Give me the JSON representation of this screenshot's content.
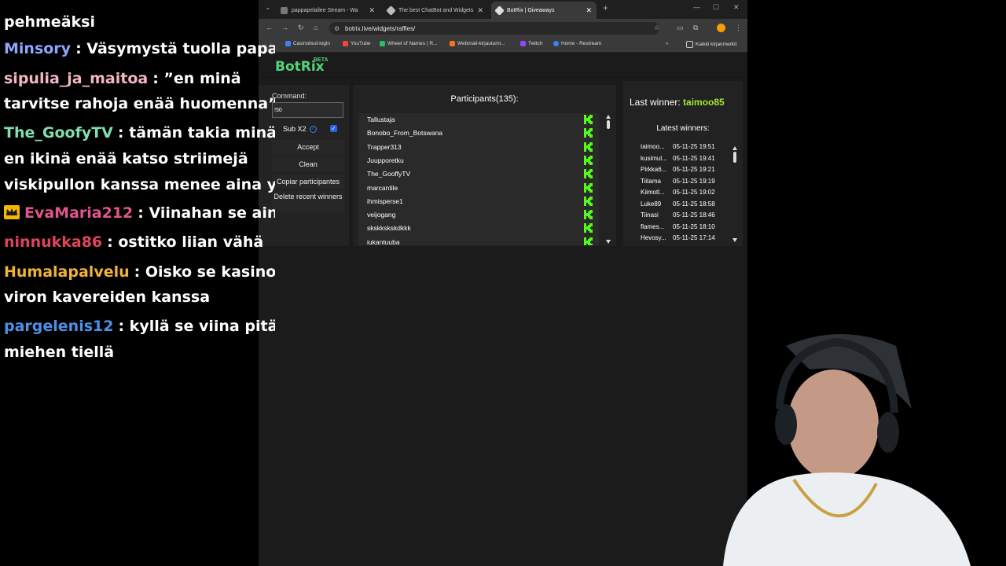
{
  "chat": {
    "messages": [
      {
        "user": "",
        "text": "pehmeäksi",
        "color": "#ffffff"
      },
      {
        "user": "Minsory",
        "text": ": Väsymystä tuolla papalla",
        "color": "#8fa8ff"
      },
      {
        "user": "sipulia_ja_maitoa",
        "text": ": ”en minä",
        "color": "#f4b6c2"
      },
      {
        "user": "",
        "text": "tarvitse rahoja enää huomenna”",
        "color": "#ffffff"
      },
      {
        "user": "The_GoofyTV",
        "text": ": tämän takia minä",
        "color": "#7fe0b0"
      },
      {
        "user": "",
        "text": "en ikinä enää katso striimejä",
        "color": "#ffffff"
      },
      {
        "user": "",
        "text": "viskipullon kanssa menee aina yli",
        "color": "#ffffff"
      },
      {
        "user": "EvaMaria212",
        "text": ": Viinahan se aina",
        "color": "#e0568a"
      },
      {
        "user": "ninnukka86",
        "text": ": ostitko liian vähä",
        "color": "#e0445a"
      },
      {
        "user": "Humalapalvelu",
        "text": ": Oisko se kasinolle",
        "color": "#f0b23a"
      },
      {
        "user": "",
        "text": "viron kavereiden kanssa",
        "color": "#ffffff"
      },
      {
        "user": "pargelenis12",
        "text": ": kyllä se viina pitää",
        "color": "#4f8fe8"
      },
      {
        "user": "",
        "text": "miehen tiellä",
        "color": "#ffffff"
      }
    ]
  },
  "browser": {
    "tabs": [
      {
        "title": "pappapelailee Stream - Wa",
        "active": false
      },
      {
        "title": "The best ChatBot and Widgets",
        "active": false
      },
      {
        "title": "BotRix | Giveaways",
        "active": true
      }
    ],
    "url": "botrix.live/widgets/raffles/",
    "bookmarks": [
      {
        "label": "Casinobud-login",
        "color": "#3b82f6"
      },
      {
        "label": "YouTube",
        "color": "#ef4444"
      },
      {
        "label": "Wheel of Names | R...",
        "color": "#22c55e"
      },
      {
        "label": "Webmail-kirjautumi...",
        "color": "#f97316"
      },
      {
        "label": "Twitch",
        "color": "#9146ff"
      },
      {
        "label": "Home - Restream",
        "color": "#3b82f6"
      }
    ],
    "all_bookmarks": "Kaikki kirjanmerkit"
  },
  "botrix": {
    "brand": "BotRix",
    "beta": "BETA",
    "command_label": "Command:",
    "command_value": "!50",
    "sub_x2_label": "Sub X2",
    "sub_x2_checked": true,
    "buttons": {
      "accept": "Accept",
      "clean": "Clean",
      "copy": "Copiar participantes",
      "delete": "Delete recent winners"
    },
    "participants_title": "Participants(135):",
    "participants": [
      "Tallustaja",
      "Bonobo_From_Botswana",
      "Trapper313",
      "Juupporetku",
      "The_GooffyTV",
      "marcantile",
      "ihmisperse1",
      "veijogang",
      "skskkskskdkkk",
      "iukantuuba"
    ],
    "platform_icon": "kick-icon",
    "platform_color": "#53fc18",
    "last_winner_label": "Last winner:",
    "last_winner": "taimoo85",
    "latest_title": "Latest winners:",
    "winners": [
      {
        "name": "taimoo...",
        "date": "05-11-25 19:51"
      },
      {
        "name": "kusimul...",
        "date": "05-11-25 19:41"
      },
      {
        "name": "Pirkka6...",
        "date": "05-11-25 19:21"
      },
      {
        "name": "Tiitama",
        "date": "05-11-25 19:19"
      },
      {
        "name": "Kiimotl...",
        "date": "05-11-25 19:02"
      },
      {
        "name": "Luke89",
        "date": "05-11-25 18:58"
      },
      {
        "name": "Tiinasi",
        "date": "05-11-25 18:46"
      },
      {
        "name": "flames...",
        "date": "05-11-25 18:10"
      },
      {
        "name": "Hevosy...",
        "date": "05-11-25 17:14"
      }
    ]
  }
}
